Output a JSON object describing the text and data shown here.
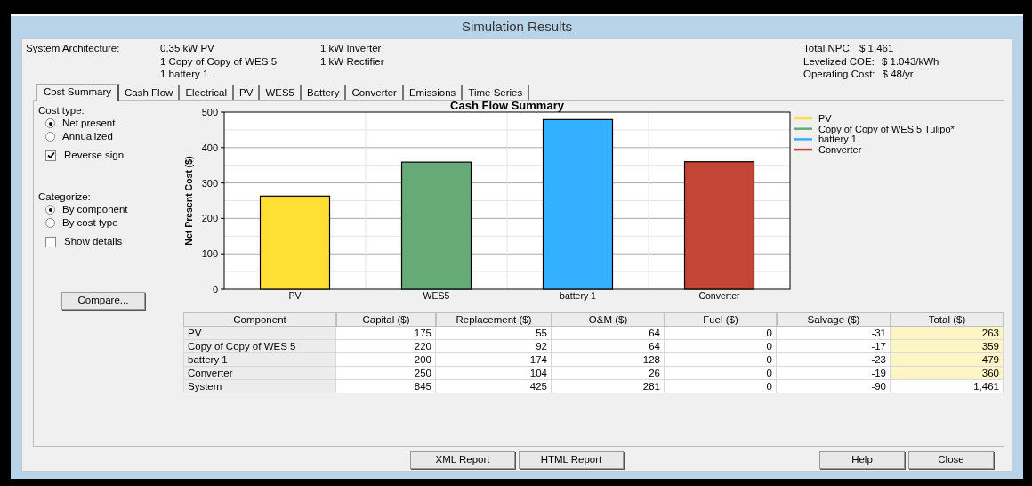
{
  "window": {
    "title": "Simulation Results"
  },
  "architecture": {
    "label": "System Architecture:",
    "col_1": [
      "0.35 kW PV",
      "1 Copy of Copy of WES 5",
      "1 battery 1"
    ],
    "col_2": [
      "1 kW Inverter",
      "1 kW Rectifier"
    ]
  },
  "summary": [
    {
      "label": "Total NPC:",
      "value": "$ 1,461"
    },
    {
      "label": "Levelized COE:",
      "value": "$ 1.043/kWh"
    },
    {
      "label": "Operating Cost:",
      "value": "$ 48/yr"
    }
  ],
  "tabs": [
    {
      "label": "Cost Summary",
      "selected": true
    },
    {
      "label": "Cash Flow",
      "selected": false
    },
    {
      "label": "Electrical",
      "selected": false
    },
    {
      "label": "PV",
      "selected": false
    },
    {
      "label": "WES5",
      "selected": false
    },
    {
      "label": "Battery",
      "selected": false
    },
    {
      "label": "Converter",
      "selected": false
    },
    {
      "label": "Emissions",
      "selected": false
    },
    {
      "label": "Time Series",
      "selected": false
    }
  ],
  "options": [
    {
      "kind": "heading",
      "label": "Cost type:"
    },
    {
      "kind": "radio",
      "label": "Net present",
      "selected": true
    },
    {
      "kind": "radio",
      "label": "Annualized",
      "selected": false
    },
    {
      "kind": "checkbox",
      "label": "Reverse sign",
      "checked": true
    },
    {
      "kind": "heading",
      "label": "Categorize:"
    },
    {
      "kind": "radio",
      "label": "By component",
      "selected": true
    },
    {
      "kind": "radio",
      "label": "By cost type",
      "selected": false
    },
    {
      "kind": "checkbox",
      "label": "Show details",
      "checked": false
    }
  ],
  "compare_button": "Compare...",
  "chart_data": {
    "type": "bar",
    "title": "Cash Flow Summary",
    "ylabel": "Net Present Cost ($)",
    "categories": [
      "PV",
      "WES5",
      "battery 1",
      "Converter"
    ],
    "ylim": [
      0,
      500
    ],
    "yticks": [
      0,
      100,
      200,
      300,
      400,
      500
    ],
    "grid": true,
    "legend": "right",
    "series": [
      {
        "name": "PV",
        "color": "#ffdf33",
        "values": [
          263,
          null,
          null,
          null
        ]
      },
      {
        "name": "Copy of Copy of WES 5 Tulipo*",
        "color": "#66aa77",
        "values": [
          null,
          359,
          null,
          null
        ]
      },
      {
        "name": "battery 1",
        "color": "#33b0ff",
        "values": [
          null,
          null,
          479,
          null
        ]
      },
      {
        "name": "Converter",
        "color": "#c44436",
        "values": [
          null,
          null,
          null,
          360
        ]
      }
    ]
  },
  "table": {
    "columns": [
      "Component",
      "Capital ($)",
      "Replacement ($)",
      "O&M ($)",
      "Fuel ($)",
      "Salvage ($)",
      "Total ($)"
    ],
    "rows": [
      {
        "cells": [
          "PV",
          "175",
          "55",
          "64",
          "0",
          "-31",
          "263"
        ],
        "highlighted": true
      },
      {
        "cells": [
          "Copy of Copy of WES 5",
          "220",
          "92",
          "64",
          "0",
          "-17",
          "359"
        ],
        "highlighted": true
      },
      {
        "cells": [
          "battery 1",
          "200",
          "174",
          "128",
          "0",
          "-23",
          "479"
        ],
        "highlighted": true
      },
      {
        "cells": [
          "Converter",
          "250",
          "104",
          "26",
          "0",
          "-19",
          "360"
        ],
        "highlighted": true
      },
      {
        "cells": [
          "System",
          "845",
          "425",
          "281",
          "0",
          "-90",
          "1,461"
        ],
        "highlighted": false
      }
    ]
  },
  "report_buttons": [
    "XML Report",
    "HTML Report"
  ],
  "dialog_buttons": [
    "Help",
    "Close"
  ]
}
